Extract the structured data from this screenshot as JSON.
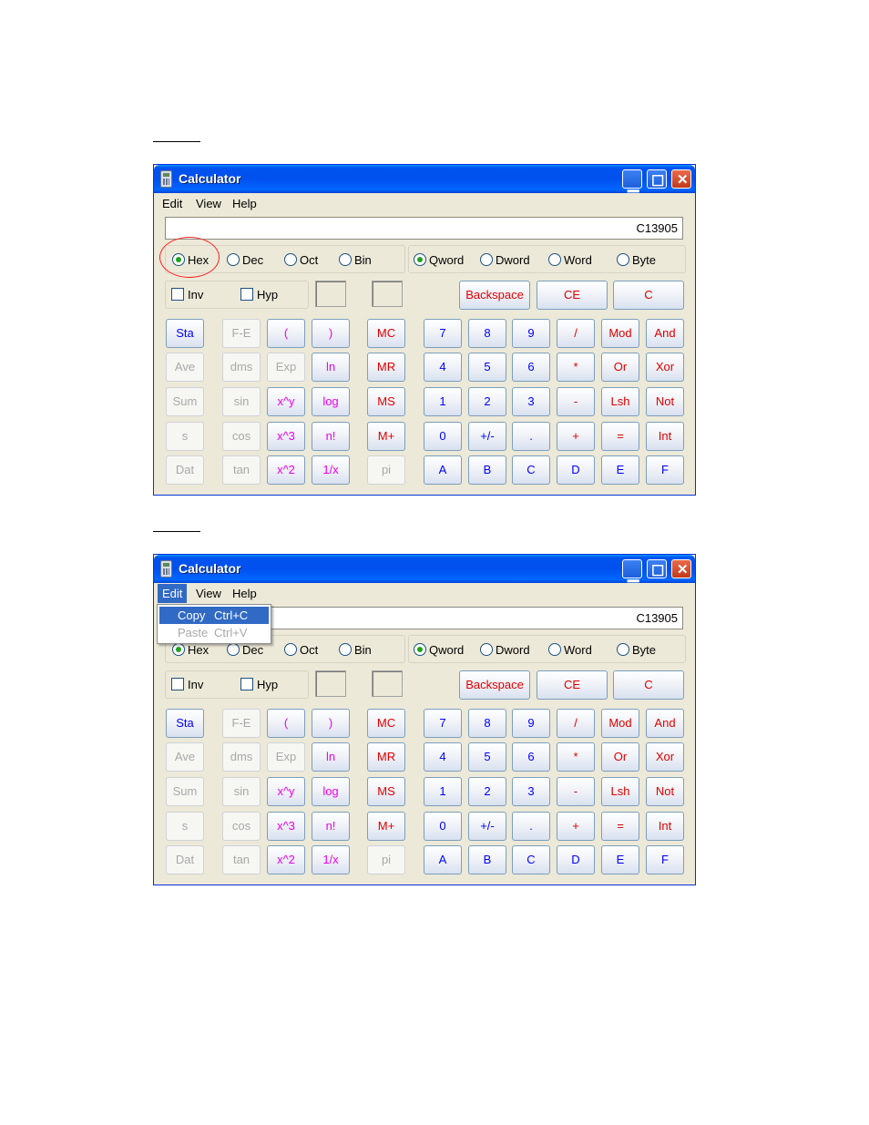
{
  "window": {
    "title": "Calculator"
  },
  "menu": [
    "Edit",
    "View",
    "Help"
  ],
  "display_value": "C13905",
  "base_options": [
    "Hex",
    "Dec",
    "Oct",
    "Bin"
  ],
  "word_options": [
    "Qword",
    "Dword",
    "Word",
    "Byte"
  ],
  "selected_base": "Hex",
  "selected_word": "Qword",
  "checkboxes": [
    "Inv",
    "Hyp"
  ],
  "top_buttons": [
    "Backspace",
    "CE",
    "C"
  ],
  "rows": [
    [
      "Sta",
      "F-E",
      "(",
      ")",
      "MC",
      "7",
      "8",
      "9",
      "/",
      "Mod",
      "And"
    ],
    [
      "Ave",
      "dms",
      "Exp",
      "ln",
      "MR",
      "4",
      "5",
      "6",
      "*",
      "Or",
      "Xor"
    ],
    [
      "Sum",
      "sin",
      "x^y",
      "log",
      "MS",
      "1",
      "2",
      "3",
      "-",
      "Lsh",
      "Not"
    ],
    [
      "s",
      "cos",
      "x^3",
      "n!",
      "M+",
      "0",
      "+/-",
      ".",
      "+",
      "=",
      "Int"
    ],
    [
      "Dat",
      "tan",
      "x^2",
      "1/x",
      "pi",
      "A",
      "B",
      "C",
      "D",
      "E",
      "F"
    ]
  ],
  "edit_menu": [
    {
      "label": "Copy",
      "shortcut": "Ctrl+C",
      "enabled": true
    },
    {
      "label": "Paste",
      "shortcut": "Ctrl+V",
      "enabled": false
    }
  ],
  "colors": {
    "titlebar": "#0054e3",
    "red_text": "#e00000",
    "magenta_text": "#ee00ee",
    "blue_text": "#0000ff",
    "disabled_text": "#a8a8a8",
    "highlight_circle": "#ff2020"
  }
}
